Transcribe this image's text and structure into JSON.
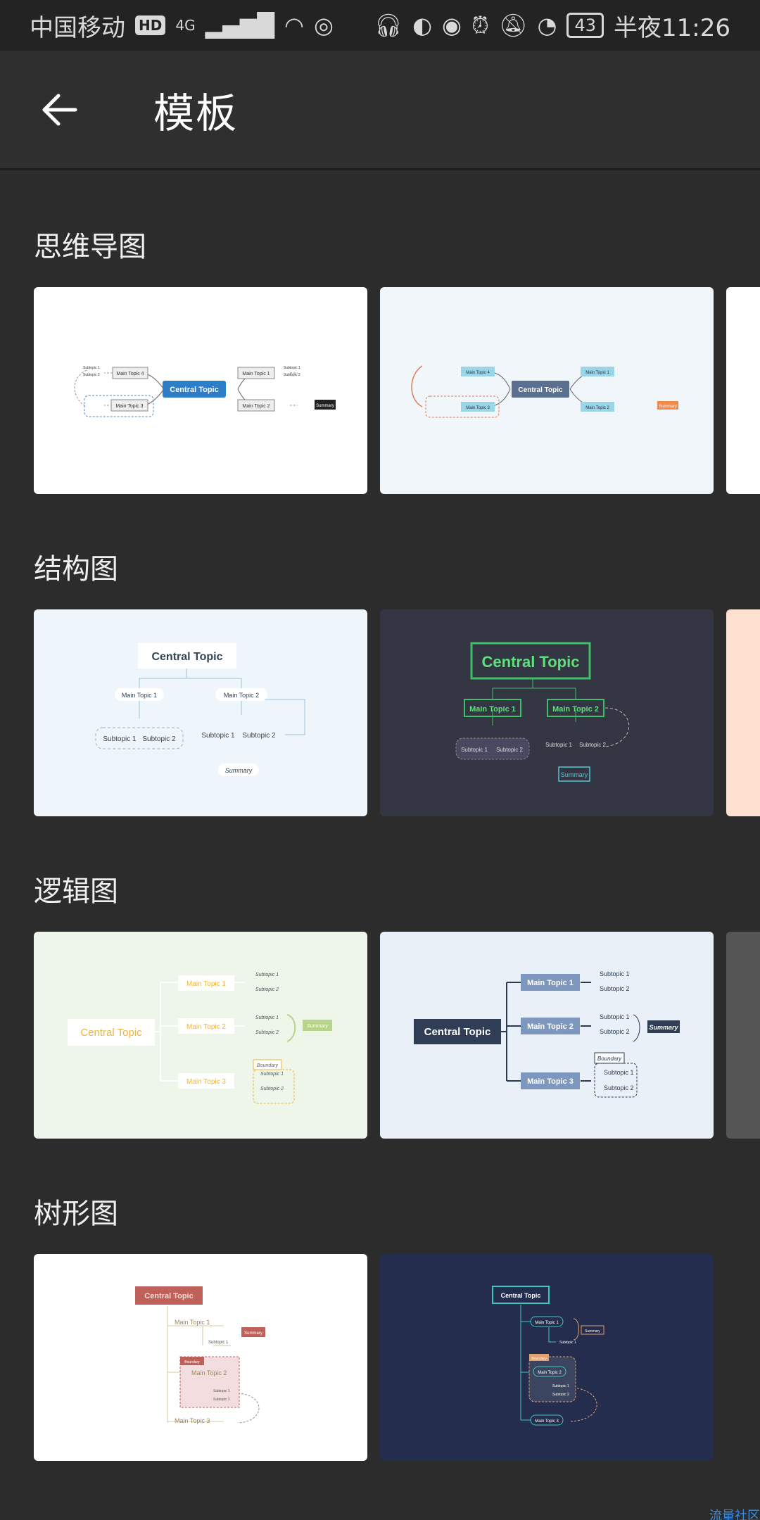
{
  "status_bar": {
    "carrier": "中国移动",
    "hd": "HD",
    "network": "4G",
    "battery": "43",
    "time": "半夜11:26",
    "icons": [
      "headphones-icon",
      "data-icon",
      "eye-icon",
      "alarm-icon",
      "bell-off-icon",
      "speed-icon"
    ]
  },
  "header": {
    "title": "模板",
    "back_icon": "arrow-left-icon"
  },
  "sections": [
    {
      "title": "思维导图"
    },
    {
      "title": "结构图"
    },
    {
      "title": "逻辑图"
    },
    {
      "title": "树形图"
    }
  ],
  "labels": {
    "central": "Central Topic",
    "mt1": "Main Topic 1",
    "mt2": "Main Topic 2",
    "mt3": "Main Topic 3",
    "mt4": "Main Topic 4",
    "st1": "Subtopic 1",
    "st2": "Subtopic 2",
    "summary": "Summary",
    "boundary": "Boundary"
  },
  "footer": {
    "link": "流量社区"
  },
  "colors": {
    "background": "#2c2c2c",
    "statusbar": "#232323",
    "appbar": "#2f2f2f",
    "card1_1": "#ffffff",
    "card1_2": "#f1f6fb",
    "card2_1": "#eef6fb",
    "card2_2": "#343542",
    "card3_1": "#eef5e9",
    "card3_2": "#e9f0f8",
    "card4_1": "#ffffff",
    "card4_2": "#252d4f",
    "peek2": "#fde0cf",
    "peek3": "#555555"
  }
}
